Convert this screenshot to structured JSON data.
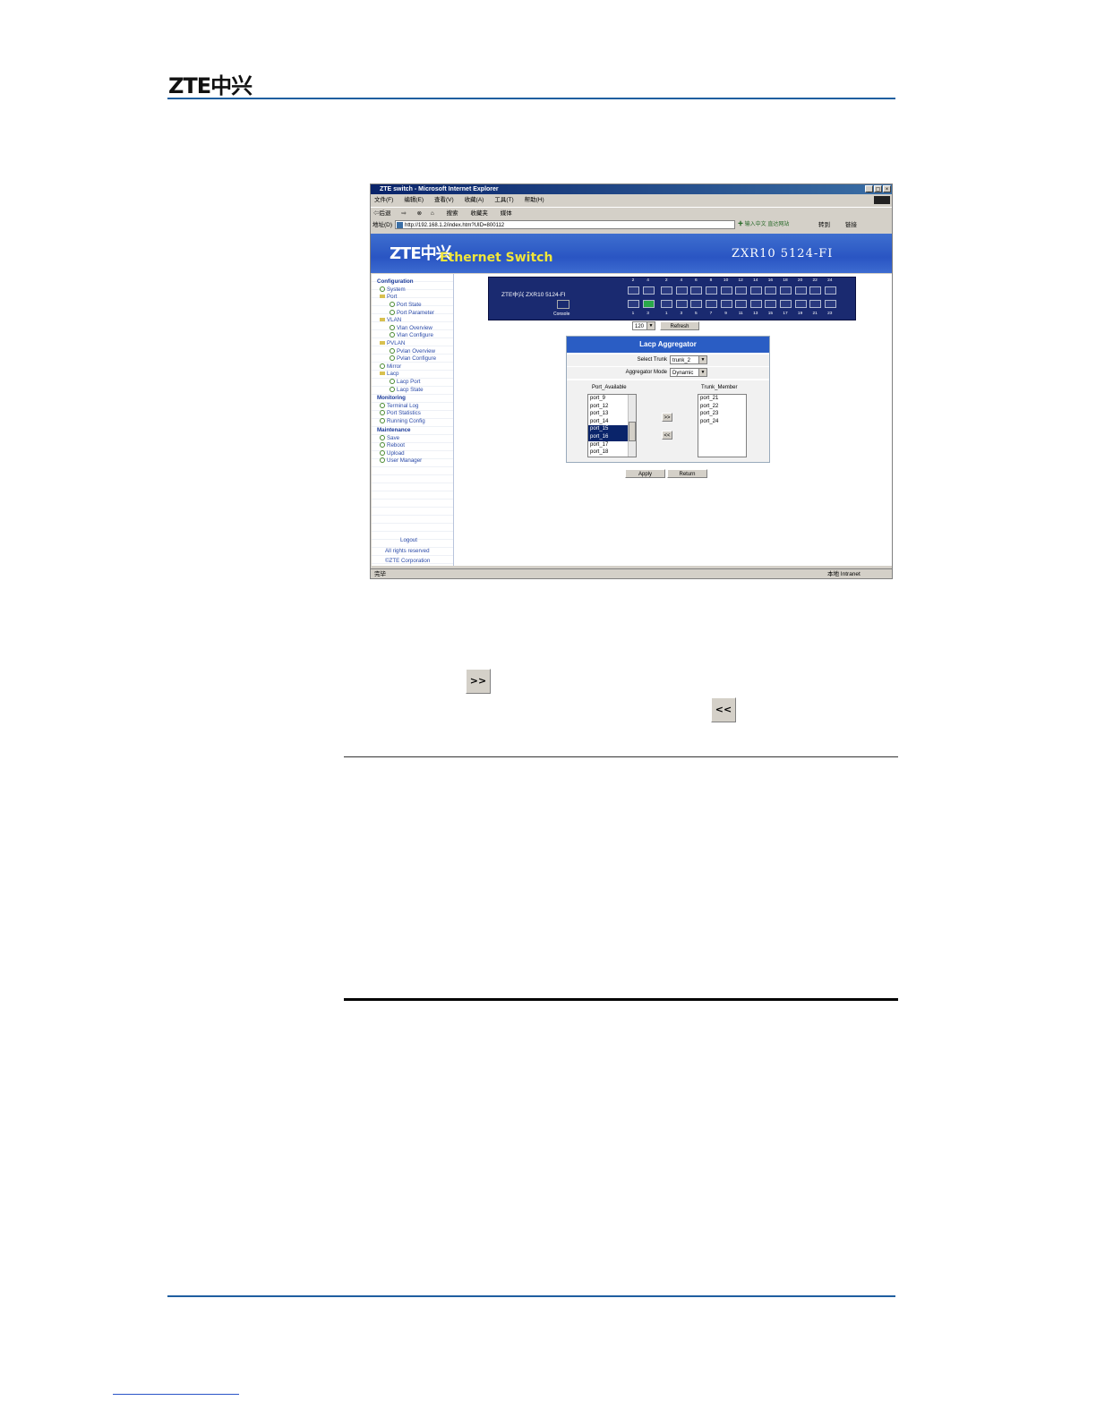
{
  "document": {
    "logo": "ZTE中兴",
    "inline_buttons": {
      "add": ">>",
      "remove": "<<"
    }
  },
  "browser": {
    "window_title": "ZTE switch - Microsoft Internet Explorer",
    "window_controls": [
      "_",
      "▢",
      "×"
    ],
    "menu": [
      "文件(F)",
      "编辑(E)",
      "查看(V)",
      "收藏(A)",
      "工具(T)",
      "帮助(H)"
    ],
    "toolbar": [
      "⇦后退",
      "⇨",
      "⊗",
      "⌂",
      "搜索",
      "收藏夹",
      "媒体"
    ],
    "address_label": "地址(D)",
    "address_url": "http://192.168.1.2/index.htm?UID=800112",
    "address_hint": "✚ 输入中文 直达网站",
    "go_label": "转到",
    "links_label": "链接",
    "status_left": "完毕",
    "status_zone": "本地 Intranet"
  },
  "app": {
    "logo": "ZTE中兴",
    "tagline": "Ethernet Switch",
    "model": "ZXR10 5124-FI",
    "panel_label": "ZTE中兴  ZXR10 5124-FI",
    "console_label": "Console",
    "ports_top": [
      "2",
      "4",
      "2",
      "4",
      "6",
      "8",
      "10",
      "12",
      "14",
      "16",
      "18",
      "20",
      "22",
      "24"
    ],
    "ports_bottom": [
      "1",
      "3",
      "1",
      "3",
      "5",
      "7",
      "9",
      "11",
      "13",
      "15",
      "17",
      "19",
      "21",
      "23"
    ],
    "refresh_interval": "120",
    "refresh_label": "Refresh",
    "nav": {
      "configuration": "Configuration",
      "system": "System",
      "port": "Port",
      "port_state": "Port State",
      "port_parameter": "Port Parameter",
      "vlan": "VLAN",
      "vlan_overview": "Vlan Overview",
      "vlan_configure": "Vlan Configure",
      "pvlan": "PVLAN",
      "pvlan_overview": "Pvlan Overview",
      "pvlan_configure": "Pvlan Configure",
      "mirror": "Mirror",
      "lacp": "Lacp",
      "lacp_port": "Lacp Port",
      "lacp_state": "Lacp State",
      "monitoring": "Monitoring",
      "terminal_log": "Terminal Log",
      "port_statistics": "Port Statistics",
      "running_config": "Running Config",
      "maintenance": "Maintenance",
      "save": "Save",
      "reboot": "Reboot",
      "upload": "Upload",
      "user_manager": "User Manager",
      "logout": "Logout",
      "rights": "All rights reserved",
      "copyright": "©ZTE Corporation"
    },
    "lacp": {
      "title": "Lacp Aggregator",
      "select_trunk_label": "Select Trunk",
      "select_trunk_value": "trunk_2",
      "mode_label": "Aggregator Mode",
      "mode_value": "Dynamic",
      "available_header": "Port_Available",
      "member_header": "Trunk_Member",
      "available_ports": [
        "port_9",
        "port_12",
        "port_13",
        "port_14",
        "port_15",
        "port_16",
        "port_17",
        "port_18"
      ],
      "selected_ports": [
        "port_15",
        "port_16"
      ],
      "member_ports": [
        "port_21",
        "port_22",
        "port_23",
        "port_24"
      ],
      "add_label": ">>",
      "remove_label": "<<",
      "apply_label": "Apply",
      "return_label": "Return"
    }
  }
}
